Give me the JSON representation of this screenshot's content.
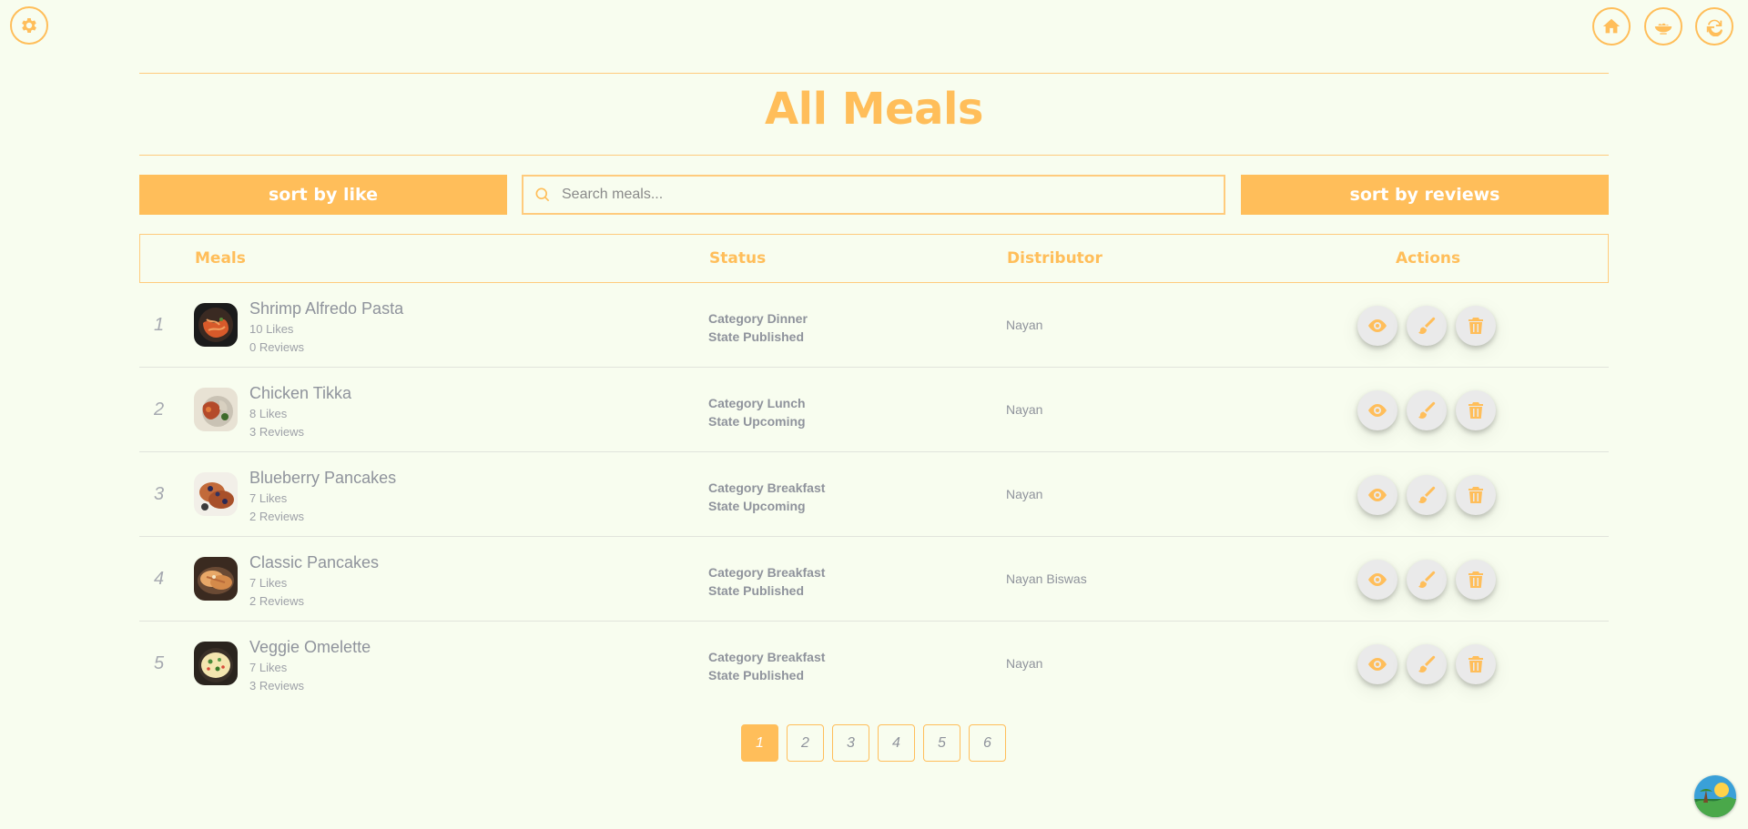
{
  "header": {
    "settings_icon": "gear-icon",
    "home_icon": "home-icon",
    "meals_icon": "bowl-icon",
    "refresh_icon": "refresh-icon"
  },
  "page": {
    "title": "All Meals"
  },
  "controls": {
    "sort_like_label": "sort by like",
    "search_placeholder": "Search meals...",
    "sort_reviews_label": "sort by reviews"
  },
  "table": {
    "headers": {
      "meals": "Meals",
      "status": "Status",
      "distributor": "Distributor",
      "actions": "Actions"
    },
    "rows": [
      {
        "num": "1",
        "name": "Shrimp Alfredo Pasta",
        "likes": "10 Likes",
        "reviews": "0 Reviews",
        "category": "Category Dinner",
        "state": "State Published",
        "distributor": "Nayan"
      },
      {
        "num": "2",
        "name": "Chicken Tikka",
        "likes": "8 Likes",
        "reviews": "3 Reviews",
        "category": "Category Lunch",
        "state": "State Upcoming",
        "distributor": "Nayan"
      },
      {
        "num": "3",
        "name": "Blueberry Pancakes",
        "likes": "7 Likes",
        "reviews": "2 Reviews",
        "category": "Category Breakfast",
        "state": "State Upcoming",
        "distributor": "Nayan"
      },
      {
        "num": "4",
        "name": "Classic Pancakes",
        "likes": "7 Likes",
        "reviews": "2 Reviews",
        "category": "Category Breakfast",
        "state": "State Published",
        "distributor": "Nayan Biswas"
      },
      {
        "num": "5",
        "name": "Veggie Omelette",
        "likes": "7 Likes",
        "reviews": "3 Reviews",
        "category": "Category Breakfast",
        "state": "State Published",
        "distributor": "Nayan"
      }
    ]
  },
  "pagination": {
    "pages": [
      "1",
      "2",
      "3",
      "4",
      "5",
      "6"
    ],
    "current": "1"
  },
  "colors": {
    "accent": "#ffbe5a",
    "background": "#f8fdef",
    "text": "#8f939c"
  }
}
